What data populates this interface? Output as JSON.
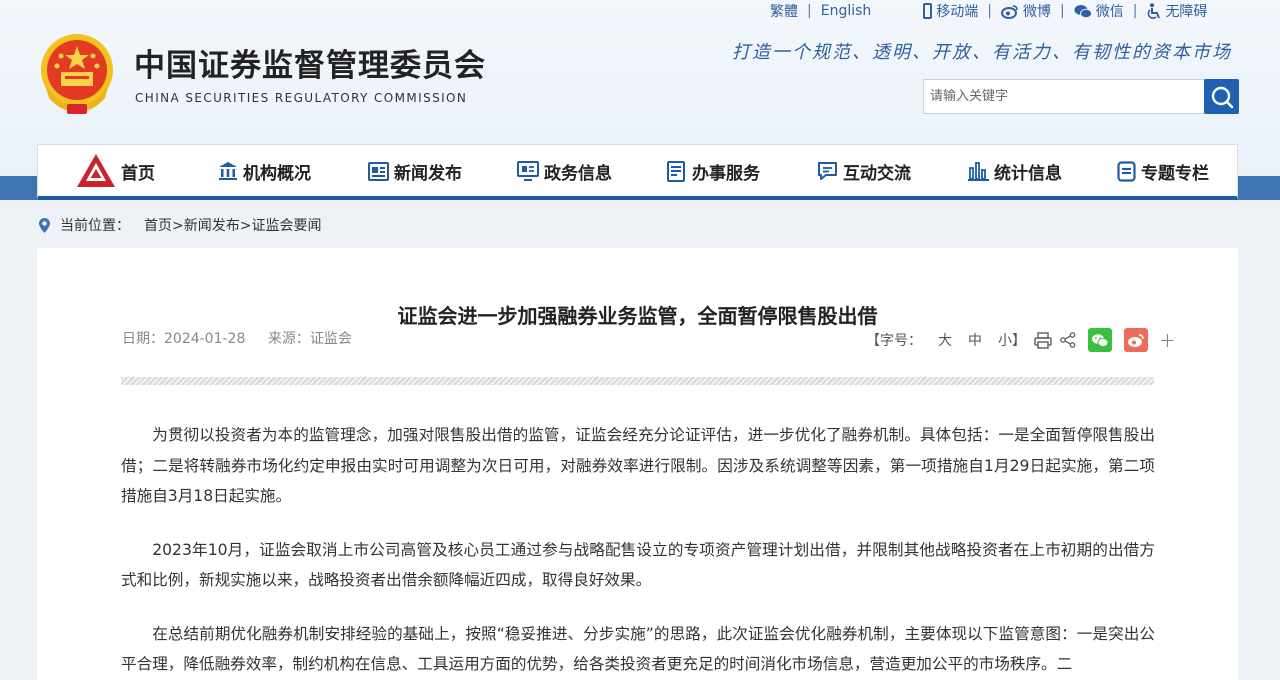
{
  "toplinks": {
    "traditional": "繁體",
    "english": "English",
    "mobile": "移动端",
    "weibo": "微博",
    "weixin": "微信",
    "accessibility": "无障碍"
  },
  "header": {
    "title_cn": "中国证券监督管理委员会",
    "title_en": "CHINA SECURITIES REGULATORY COMMISSION",
    "slogan": "打造一个规范、透明、开放、有活力、有韧性的资本市场"
  },
  "search": {
    "placeholder": "请输入关键字"
  },
  "nav": {
    "items": [
      {
        "label": "首页",
        "icon": "home-logo-icon"
      },
      {
        "label": "机构概况",
        "icon": "building-icon"
      },
      {
        "label": "新闻发布",
        "icon": "news-icon"
      },
      {
        "label": "政务信息",
        "icon": "monitor-icon"
      },
      {
        "label": "办事服务",
        "icon": "document-list-icon"
      },
      {
        "label": "互动交流",
        "icon": "chat-icon"
      },
      {
        "label": "统计信息",
        "icon": "bar-chart-icon"
      },
      {
        "label": "专题专栏",
        "icon": "file-icon"
      }
    ]
  },
  "breadcrumb": {
    "label": "当前位置：",
    "path": "首页>新闻发布>证监会要闻"
  },
  "article": {
    "title": "证监会进一步加强融券业务监管，全面暂停限售股出借",
    "date": "日期：2024-01-28",
    "source": "来源：证监会",
    "font_label": "【字号：",
    "font_large": "大",
    "font_medium": "中",
    "font_small": "小】",
    "share_plus": "+",
    "paragraphs": [
      "为贯彻以投资者为本的监管理念，加强对限售股出借的监管，证监会经充分论证评估，进一步优化了融券机制。具体包括：一是全面暂停限售股出借；二是将转融券市场化约定申报由实时可用调整为次日可用，对融券效率进行限制。因涉及系统调整等因素，第一项措施自1月29日起实施，第二项措施自3月18日起实施。",
      "2023年10月，证监会取消上市公司高管及核心员工通过参与战略配售设立的专项资产管理计划出借，并限制其他战略投资者在上市初期的出借方式和比例，新规实施以来，战略投资者出借余额降幅近四成，取得良好效果。",
      "在总结前期优化融券机制安排经验的基础上，按照“稳妥推进、分步实施”的思路，此次证监会优化融券机制，主要体现以下监管意图：一是突出公平合理，降低融券效率，制约机构在信息、工具运用方面的优势，给各类投资者更充足的时间消化市场信息，营造更加公平的市场秩序。二"
    ]
  },
  "colors": {
    "brand_blue": "#1f5aa6",
    "band_blue": "#3f74b3",
    "link_blue": "#2f5f9e",
    "weixin_green": "#3bbf3e",
    "weibo_red": "#ee6a5c"
  }
}
